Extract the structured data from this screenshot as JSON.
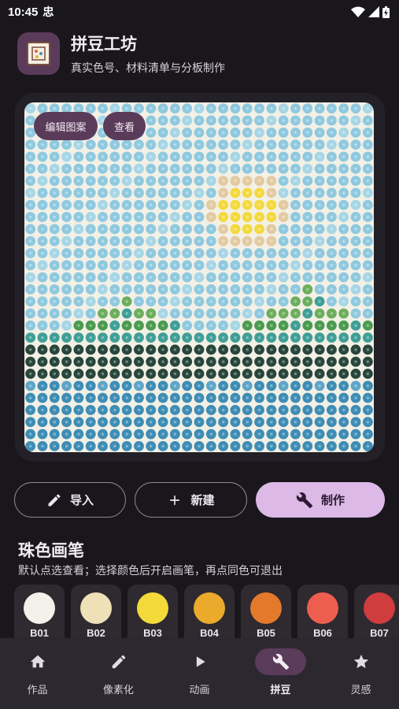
{
  "status": {
    "time": "10:45",
    "extra": "忠"
  },
  "app": {
    "title": "拼豆工坊",
    "subtitle": "真实色号、材料清单与分板制作"
  },
  "board": {
    "overlay_buttons": {
      "edit": "编辑图案",
      "view": "查看"
    },
    "grid_size": 29,
    "background": "#f3f0e6"
  },
  "actions": {
    "import": "导入",
    "new": "新建",
    "make": "制作"
  },
  "palette_section": {
    "title": "珠色画笔",
    "description": "默认点选查看；选择颜色后开启画笔，再点同色可退出",
    "swatches": [
      {
        "code": "B01",
        "color": "#f4f1ea"
      },
      {
        "code": "B02",
        "color": "#efe1b7"
      },
      {
        "code": "B03",
        "color": "#f4d93b"
      },
      {
        "code": "B04",
        "color": "#ecaa2c"
      },
      {
        "code": "B05",
        "color": "#e5792b"
      },
      {
        "code": "B06",
        "color": "#ee5e4e"
      },
      {
        "code": "B07",
        "color": "#cf3d3e"
      }
    ]
  },
  "nav": {
    "items": [
      {
        "label": "作品",
        "icon": "home-icon"
      },
      {
        "label": "像素化",
        "icon": "pencil-icon"
      },
      {
        "label": "动画",
        "icon": "play-icon"
      },
      {
        "label": "拼豆",
        "icon": "wrench-icon"
      },
      {
        "label": "灵感",
        "icon": "star-icon"
      }
    ],
    "active": 3
  },
  "colors": {
    "accent": "#dcb9e6",
    "chip": "#5b3b5a",
    "sky": "#8fc9df",
    "sky_light": "#a7d6e6",
    "sun": "#f3d93e",
    "sun_halo": "#e2cba2",
    "grass_light": "#6dae5e",
    "grass_dark": "#4b9a50",
    "teal": "#3f9f96",
    "forest": "#28463b",
    "water": "#3e8db5",
    "water_light": "#5fa5c8"
  }
}
